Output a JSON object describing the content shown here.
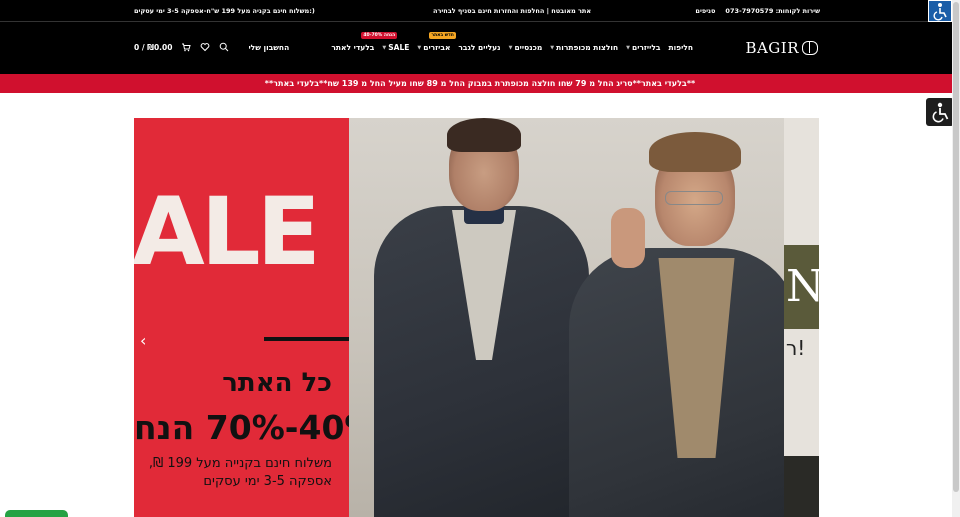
{
  "topbar": {
    "left_text": "משלוח חינם בקניה מעל 199 ש\"ח-אספקה 3-5 ימי עסקים:)",
    "center_text": "אתר מאובטח | החלפות והחזרות חינם בסניף לבחירה",
    "phone": "שירות לקוחות: 073-7970579",
    "stores": "סניפים"
  },
  "nav": {
    "logo": "BAGIR",
    "menu": [
      {
        "label": "חליפות",
        "caret": false
      },
      {
        "label": "בלייזרים",
        "caret": true
      },
      {
        "label": "חולצות מכופתרות",
        "caret": true
      },
      {
        "label": "מכנסיים",
        "caret": true
      },
      {
        "label": "נעליים לגבר",
        "caret": false
      },
      {
        "label": "אביזרים",
        "caret": true,
        "badge": "חדש באתר"
      },
      {
        "label": "SALE",
        "caret": true
      },
      {
        "label": "בלעדי לאתר",
        "caret": false,
        "badge": "40-70% הנחה"
      }
    ],
    "account": "החשבון שלי",
    "cart": "0 / ₪0.00",
    "badge_colors": {
      "yellow": "#f5a623",
      "red": "#d0102e"
    }
  },
  "promo": {
    "text": "**בלעדי באתר**סריג החל מ 79 שחו חולצה מכופתרת במבוק החל מ 89 שחו מעיל החל מ 139 שח**בלעדי באתר**"
  },
  "hero": {
    "sale_word": "ALE",
    "line1": "כל האתר",
    "line2": "40%-70% הנח",
    "line3a": "משלוח חינם בקנייה מעל 199 ₪,",
    "line3b": "אספקה 3-5 ימי עסקים",
    "next_slide_letter": "N",
    "next_slide_text": "ר!",
    "arrow": "‹"
  },
  "icons": {
    "search": "search-icon",
    "wishlist": "heart-icon",
    "cart": "cart-icon",
    "accessibility": "accessibility-icon"
  }
}
